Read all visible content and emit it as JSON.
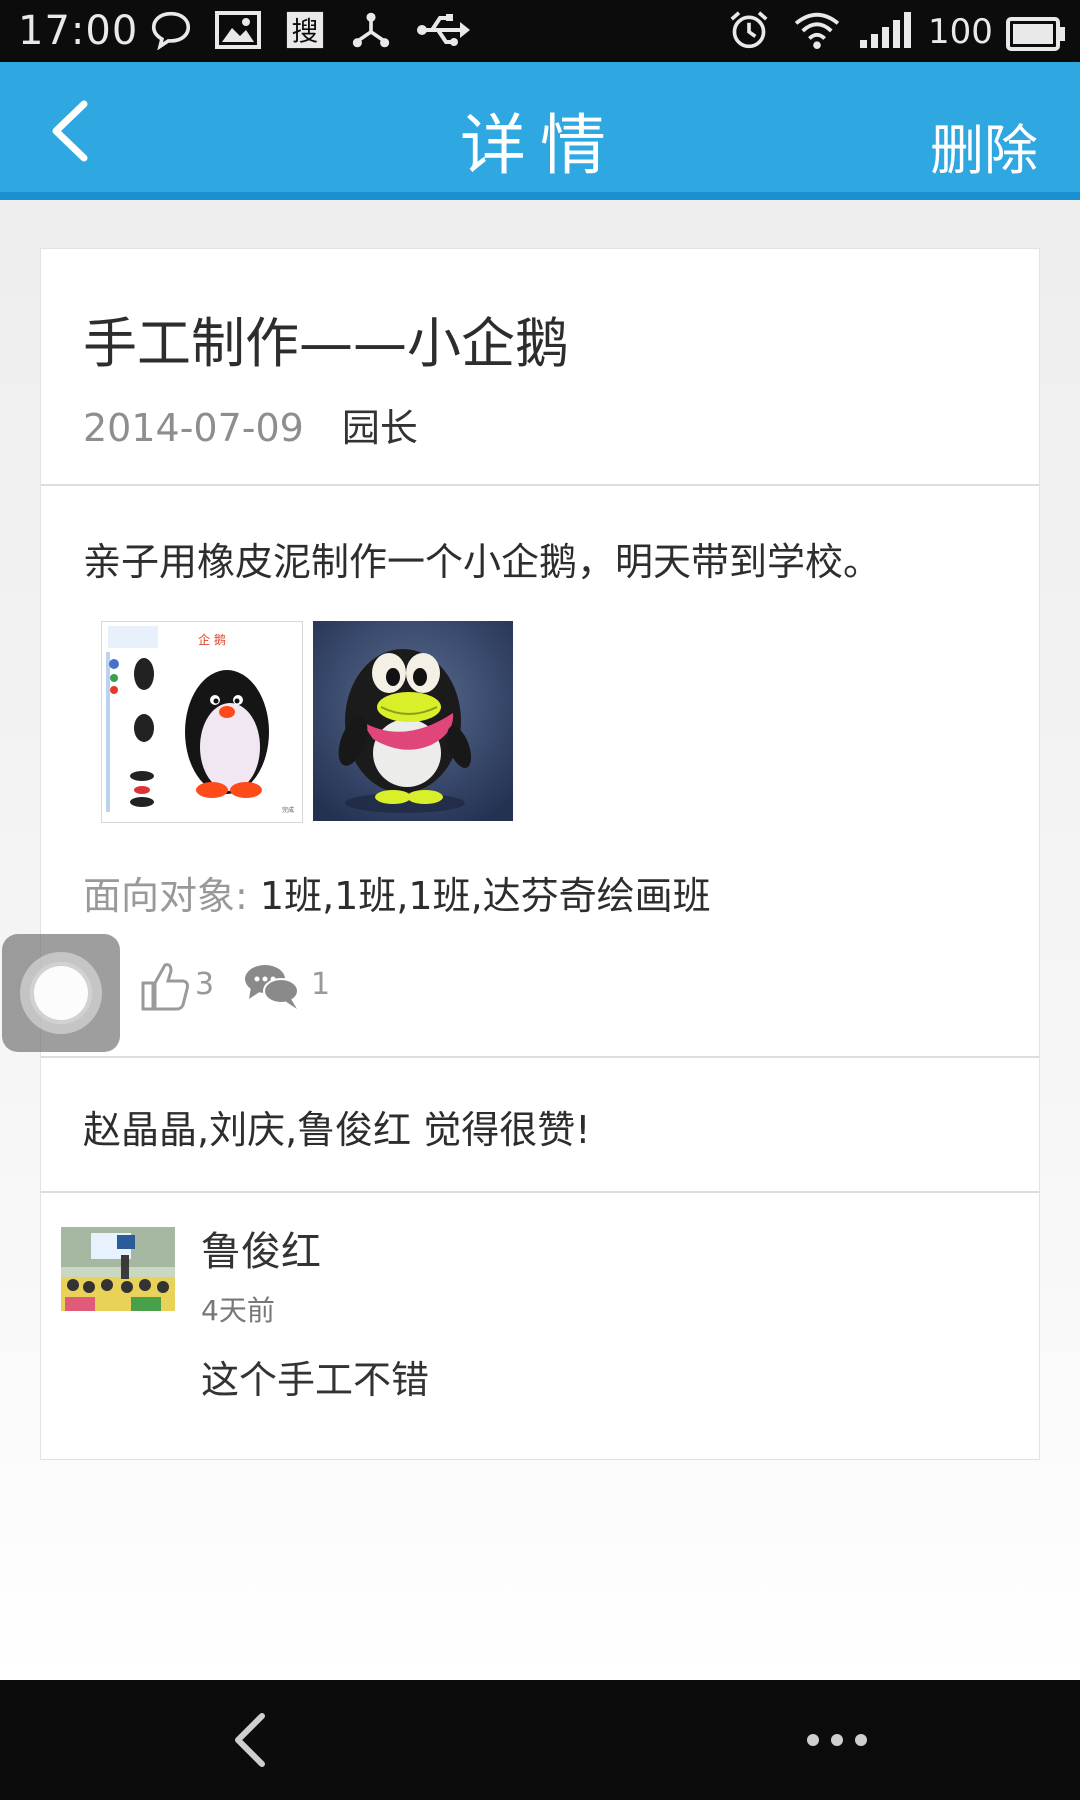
{
  "status_bar": {
    "time": "17:00",
    "battery_text": "100",
    "icons": [
      "chat-bubble-icon",
      "image-icon",
      "sogou-search-icon",
      "share-icon",
      "usb-icon",
      "alarm-icon",
      "wifi-icon",
      "signal-icon",
      "battery-icon"
    ]
  },
  "app_bar": {
    "title": "详情",
    "action_label": "删除",
    "back_icon": "chevron-left-icon"
  },
  "post": {
    "title": "手工制作——小企鹅",
    "date": "2014-07-09",
    "author": "园长",
    "content": "亲子用橡皮泥制作一个小企鹅，明天带到学校。",
    "images": [
      {
        "name": "penguin-instruction-image",
        "heading": "企 鹅"
      },
      {
        "name": "clay-penguin-photo"
      }
    ],
    "audience_label": "面向对象: ",
    "audience_value": "1班,1班,1班,达芬奇绘画班",
    "like_count": "3",
    "comment_count": "1"
  },
  "likes_text": "赵晶晶,刘庆,鲁俊红 觉得很赞!",
  "comments": [
    {
      "name": "鲁俊红",
      "time": "4天前",
      "text": "这个手工不错"
    }
  ],
  "colors": {
    "app_bar": "#2fa7e0",
    "app_bar_border": "#1a8fd0",
    "status_bar": "#0c0c0c",
    "nav_bar": "#0c0c0c"
  }
}
